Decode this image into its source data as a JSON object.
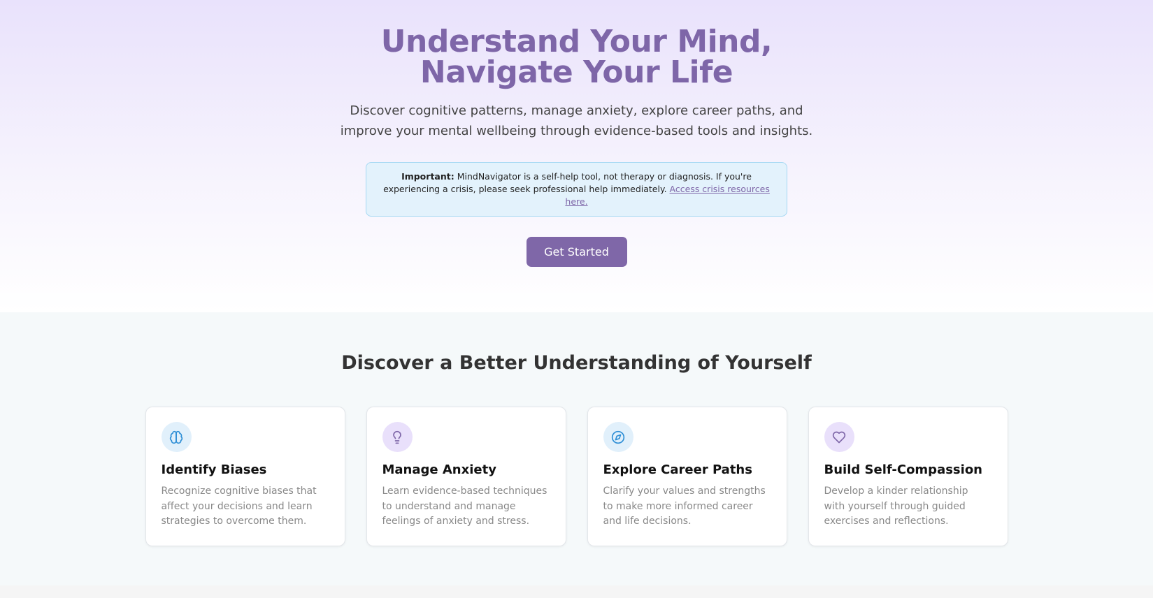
{
  "hero": {
    "title": "Understand Your Mind, Navigate Your Life",
    "subtitle": "Discover cognitive patterns, manage anxiety, explore career paths, and improve your mental wellbeing through evidence-based tools and insights.",
    "notice": {
      "label": "Important:",
      "text": " MindNavigator is a self-help tool, not therapy or diagnosis. If you're experiencing a crisis, please seek professional help immediately. ",
      "link": "Access crisis resources here."
    },
    "cta_label": "Get Started"
  },
  "features": {
    "heading": "Discover a Better Understanding of Yourself",
    "cards": [
      {
        "icon": "brain-icon",
        "title": "Identify Biases",
        "description": "Recognize cognitive biases that affect your decisions and learn strategies to overcome them."
      },
      {
        "icon": "lightbulb-icon",
        "title": "Manage Anxiety",
        "description": "Learn evidence-based techniques to understand and manage feelings of anxiety and stress."
      },
      {
        "icon": "compass-icon",
        "title": "Explore Career Paths",
        "description": "Clarify your values and strengths to make more informed career and life decisions."
      },
      {
        "icon": "heart-icon",
        "title": "Build Self-Compassion",
        "description": "Develop a kinder relationship with yourself through guided exercises and reflections."
      }
    ]
  },
  "colors": {
    "brand": "#7e66a8",
    "notice_bg": "#e3f2fc",
    "icon_blue": "#2f8fd6"
  }
}
